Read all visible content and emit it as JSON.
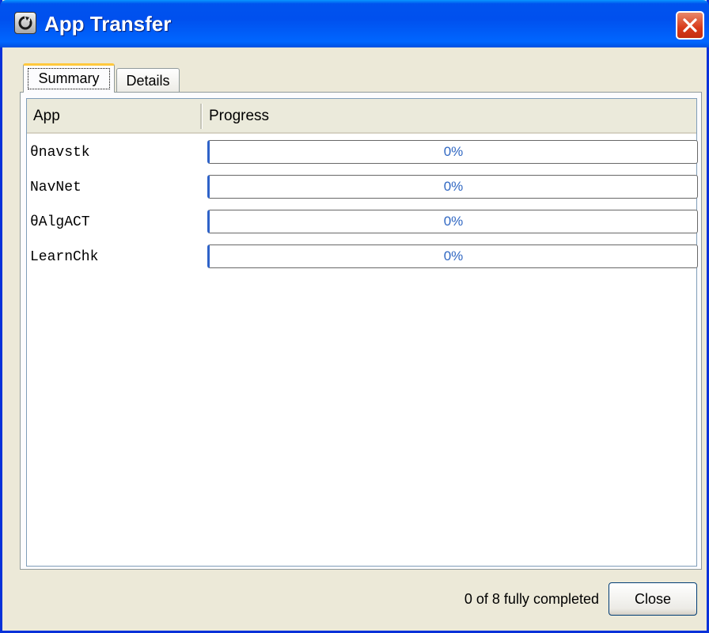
{
  "window": {
    "title": "App Transfer"
  },
  "tabs": [
    {
      "label": "Summary",
      "active": true
    },
    {
      "label": "Details",
      "active": false
    }
  ],
  "table": {
    "columns": [
      "App",
      "Progress"
    ],
    "rows": [
      {
        "app": "θnavstk",
        "progress": "0%"
      },
      {
        "app": "NavNet",
        "progress": "0%"
      },
      {
        "app": "θAlgACT",
        "progress": "0%"
      },
      {
        "app": "LearnChk",
        "progress": "0%"
      }
    ]
  },
  "footer": {
    "status": "0 of 8 fully completed",
    "close_label": "Close"
  },
  "icons": {
    "window_icon": "app-logo-icon",
    "close": "close-icon"
  },
  "colors": {
    "titlebar": "#0054e3",
    "progress_text": "#3067c2",
    "tab_highlight": "#ffc83c"
  }
}
